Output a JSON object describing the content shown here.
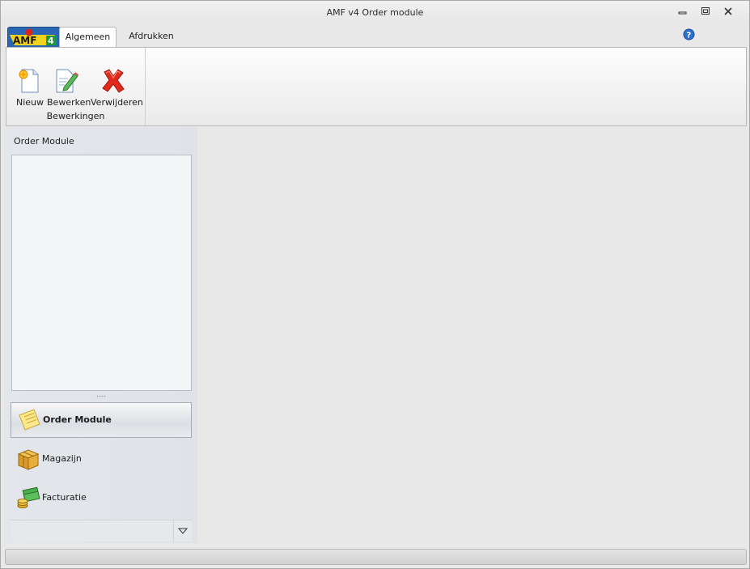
{
  "window": {
    "title": "AMF v4 Order module",
    "controls": [
      "minimize-icon",
      "restore-icon",
      "close-icon"
    ]
  },
  "app_button": {
    "logo_text": "AMF4",
    "icon": "amf4-logo"
  },
  "tabs": [
    {
      "label": "Algemeen",
      "active": true
    },
    {
      "label": "Afdrukken",
      "active": false
    }
  ],
  "help": {
    "icon": "help-icon"
  },
  "ribbon": {
    "groups": [
      {
        "label": "Bewerkingen",
        "buttons": [
          {
            "label": "Nieuw",
            "icon": "new-document-icon"
          },
          {
            "label": "Bewerken",
            "icon": "edit-document-icon"
          },
          {
            "label": "Verwijderen",
            "icon": "delete-x-icon"
          }
        ]
      }
    ]
  },
  "navigation": {
    "header": "Order Module",
    "items": [
      {
        "label": "Order Module",
        "icon": "notepad-icon",
        "selected": true
      },
      {
        "label": "Magazijn",
        "icon": "boxes-icon",
        "selected": false
      },
      {
        "label": "Facturatie",
        "icon": "money-icon",
        "selected": false
      }
    ],
    "footer_dropdown_icon": "chevron-down-icon"
  },
  "colors": {
    "accent_blue": "#1f56a0",
    "delete_red": "#e02a1c",
    "nav_selected_border": "#a6acb5"
  }
}
